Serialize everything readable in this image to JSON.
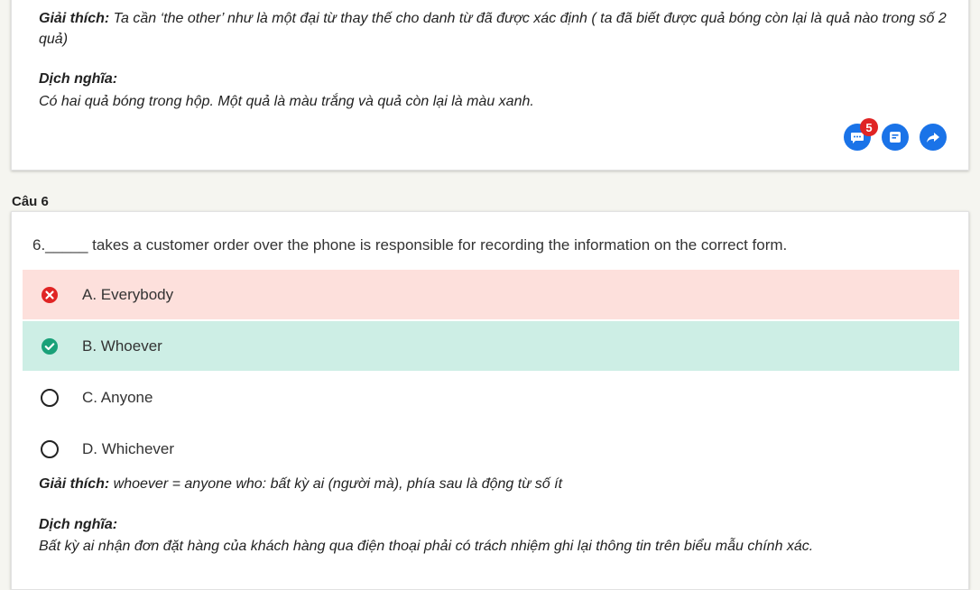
{
  "prev_card": {
    "explanation_label": "Giải thích:",
    "explanation_text": " Ta cần ‘the other’ như là một đại từ thay thế cho danh từ đã được xác định ( ta đã biết được quả bóng còn lại là quả nào trong số 2 quả)",
    "translation_label": "Dịch nghĩa:",
    "translation_text": "Có hai quả bóng trong hộp. Một quả là màu trắng và quả còn lại là màu xanh.",
    "comment_badge": "5",
    "icons": [
      "comment-icon",
      "note-icon",
      "share-icon"
    ]
  },
  "question": {
    "heading": "Câu 6",
    "text": "6._____ takes a customer order over the phone is responsible for recording the information on the correct form.",
    "options": [
      {
        "label": "A. Everybody",
        "state": "wrong"
      },
      {
        "label": "B. Whoever",
        "state": "correct"
      },
      {
        "label": "C. Anyone",
        "state": "unselected"
      },
      {
        "label": "D. Whichever",
        "state": "unselected"
      }
    ],
    "explanation_label": "Giải thích:",
    "explanation_text": " whoever = anyone who: bất kỳ ai (người mà), phía sau là động từ số ít",
    "translation_label": "Dịch nghĩa:",
    "translation_text": "Bất kỳ ai nhận đơn đặt hàng của khách hàng qua điện thoại phải có trách nhiệm ghi lại thông tin trên biểu mẫu chính xác."
  },
  "colors": {
    "wrong_bg": "#fde0dc",
    "correct_bg": "#cdeee5",
    "wrong_icon": "#e02424",
    "correct_icon": "#1aa179",
    "action_blue": "#1a73e8"
  }
}
